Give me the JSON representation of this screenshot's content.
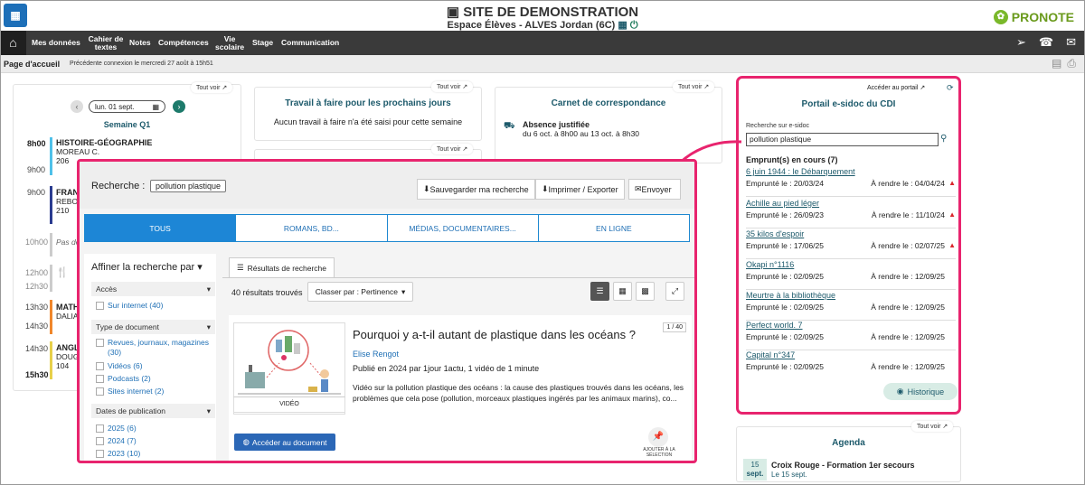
{
  "header": {
    "title": "SITE DE DEMONSTRATION",
    "subtitle": "Espace Élèves - ALVES Jordan (6C)",
    "brand": "PRONOTE"
  },
  "nav": {
    "items": [
      "Mes données",
      "Cahier de textes",
      "Notes",
      "Compétences",
      "Vie scolaire",
      "Stage",
      "Communication"
    ]
  },
  "subbar": {
    "page": "Page d'accueil",
    "last_connection": "Précédente connexion le mercredi 27 août à 15h51"
  },
  "tout_voir": "Tout voir",
  "agenda_left": {
    "date": "lun. 01 sept.",
    "week": "Semaine Q1",
    "events": [
      {
        "start": "8h00",
        "end": "9h00",
        "subject": "HISTOIRE-GÉOGRAPHIE",
        "teacher": "MOREAU C.",
        "room": "206",
        "color": "#4fc1e9"
      },
      {
        "start": "9h00",
        "end": "",
        "subject": "FRANÇAIS",
        "teacher": "REBOUL",
        "room": "210",
        "color": "#2a3b8f"
      },
      {
        "start": "10h00",
        "end": "",
        "subject": "Pas de cours",
        "teacher": "",
        "room": "",
        "color": "#cccccc"
      },
      {
        "start": "12h00",
        "end": "12h30",
        "subject": "",
        "teacher": "",
        "room": "",
        "color": "#cccccc"
      },
      {
        "start": "13h30",
        "end": "14h30",
        "subject": "MATHÉMATIQUES",
        "teacher": "DALIA",
        "room": "",
        "color": "#f0872c"
      },
      {
        "start": "14h30",
        "end": "15h30",
        "subject": "ANGLAIS",
        "teacher": "DOUGLAS",
        "room": "104",
        "color": "#e7d04a"
      }
    ]
  },
  "cards": {
    "travail_title": "Travail à faire pour les prochains jours",
    "travail_text": "Aucun travail à faire n'a été saisi pour cette semaine",
    "carnet_title": "Carnet de correspondance",
    "absence_title": "Absence justifiée",
    "absence_text": "du 6 oct. à 8h00 au 13 oct. à 8h30"
  },
  "search": {
    "label": "Recherche :",
    "query": "pollution plastique",
    "toolbar": {
      "save": "Sauvegarder ma recherche",
      "print": "Imprimer / Exporter",
      "send": "Envoyer"
    },
    "tabs": [
      "TOUS",
      "ROMANS, BD...",
      "MÉDIAS, DOCUMENTAIRES...",
      "EN LIGNE"
    ],
    "refine": {
      "title": "Affiner la recherche par",
      "access_label": "Accès",
      "access_items": [
        "Sur internet (40)"
      ],
      "type_label": "Type de document",
      "type_items": [
        "Revues, journaux, magazines (30)",
        "Vidéos (6)",
        "Podcasts (2)",
        "Sites internet (2)"
      ],
      "dates_label": "Dates de publication",
      "dates_items": [
        "2025 (6)",
        "2024 (7)",
        "2023 (10)"
      ]
    },
    "results_tab": "Résultats de recherche",
    "count": "40 résultats trouvés",
    "sort": "Classer par : Pertinence",
    "result": {
      "title": "Pourquoi y a-t-il autant de plastique dans les océans ?",
      "position": "1 / 40",
      "author": "Elise Rengot",
      "published": "Publié en 2024 par 1jour 1actu, 1 vidéo de 1 minute",
      "description": "Vidéo sur la pollution plastique des océans : la cause des plastiques trouvés dans les océans, les problèmes que cela pose (pollution, morceaux plastiques ingérés par les animaux marins), co...",
      "media": "VIDÉO",
      "access": "Accéder au document",
      "pin": "AJOUTER À LA SÉLECTION"
    }
  },
  "esidoc": {
    "portal_link": "Accéder au portail",
    "title": "Portail e-sidoc du CDI",
    "search_label": "Recherche sur e-sidoc",
    "search_value": "pollution plastique",
    "loans_title": "Emprunt(s) en cours (7)",
    "loans": [
      {
        "title": "6 juin 1944 : le Débarquement",
        "borrowed": "Emprunté le : 20/03/24",
        "due": "À rendre le : 04/04/24",
        "late": true
      },
      {
        "title": "Achille au pied léger",
        "borrowed": "Emprunté le : 26/09/23",
        "due": "À rendre le : 11/10/24",
        "late": true
      },
      {
        "title": "35 kilos d'espoir",
        "borrowed": "Emprunté le : 17/06/25",
        "due": "À rendre le : 02/07/25",
        "late": true
      },
      {
        "title": "Okapi n°1116",
        "borrowed": "Emprunté le : 02/09/25",
        "due": "À rendre le : 12/09/25",
        "late": false
      },
      {
        "title": "Meurtre à la bibliothèque",
        "borrowed": "Emprunté le : 02/09/25",
        "due": "À rendre le : 12/09/25",
        "late": false
      },
      {
        "title": "Perfect world. 7",
        "borrowed": "Emprunté le : 02/09/25",
        "due": "À rendre le : 12/09/25",
        "late": false
      },
      {
        "title": "Capital n°347",
        "borrowed": "Emprunté le : 02/09/25",
        "due": "À rendre le : 12/09/25",
        "late": false
      }
    ],
    "history": "Historique"
  },
  "agenda_right": {
    "title": "Agenda",
    "day": "15",
    "month": "sept.",
    "event": "Croix Rouge - Formation 1er secours",
    "date": "Le 15 sept."
  },
  "colors": {
    "accent": "#e8246e",
    "nav": "#3a3a3a",
    "tab_active": "#1d86d6",
    "brand": "#7ab82a"
  }
}
